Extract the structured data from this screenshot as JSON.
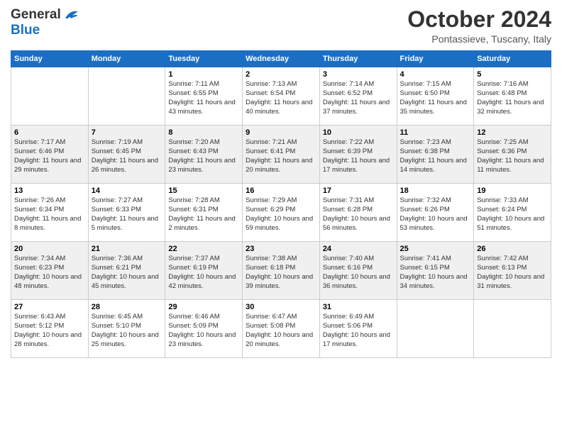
{
  "logo": {
    "general": "General",
    "blue": "Blue"
  },
  "title": "October 2024",
  "location": "Pontassieve, Tuscany, Italy",
  "days_of_week": [
    "Sunday",
    "Monday",
    "Tuesday",
    "Wednesday",
    "Thursday",
    "Friday",
    "Saturday"
  ],
  "weeks": [
    [
      {
        "day": "",
        "info": ""
      },
      {
        "day": "",
        "info": ""
      },
      {
        "day": "1",
        "info": "Sunrise: 7:11 AM\nSunset: 6:55 PM\nDaylight: 11 hours and 43 minutes."
      },
      {
        "day": "2",
        "info": "Sunrise: 7:13 AM\nSunset: 6:54 PM\nDaylight: 11 hours and 40 minutes."
      },
      {
        "day": "3",
        "info": "Sunrise: 7:14 AM\nSunset: 6:52 PM\nDaylight: 11 hours and 37 minutes."
      },
      {
        "day": "4",
        "info": "Sunrise: 7:15 AM\nSunset: 6:50 PM\nDaylight: 11 hours and 35 minutes."
      },
      {
        "day": "5",
        "info": "Sunrise: 7:16 AM\nSunset: 6:48 PM\nDaylight: 11 hours and 32 minutes."
      }
    ],
    [
      {
        "day": "6",
        "info": "Sunrise: 7:17 AM\nSunset: 6:46 PM\nDaylight: 11 hours and 29 minutes."
      },
      {
        "day": "7",
        "info": "Sunrise: 7:19 AM\nSunset: 6:45 PM\nDaylight: 11 hours and 26 minutes."
      },
      {
        "day": "8",
        "info": "Sunrise: 7:20 AM\nSunset: 6:43 PM\nDaylight: 11 hours and 23 minutes."
      },
      {
        "day": "9",
        "info": "Sunrise: 7:21 AM\nSunset: 6:41 PM\nDaylight: 11 hours and 20 minutes."
      },
      {
        "day": "10",
        "info": "Sunrise: 7:22 AM\nSunset: 6:39 PM\nDaylight: 11 hours and 17 minutes."
      },
      {
        "day": "11",
        "info": "Sunrise: 7:23 AM\nSunset: 6:38 PM\nDaylight: 11 hours and 14 minutes."
      },
      {
        "day": "12",
        "info": "Sunrise: 7:25 AM\nSunset: 6:36 PM\nDaylight: 11 hours and 11 minutes."
      }
    ],
    [
      {
        "day": "13",
        "info": "Sunrise: 7:26 AM\nSunset: 6:34 PM\nDaylight: 11 hours and 8 minutes."
      },
      {
        "day": "14",
        "info": "Sunrise: 7:27 AM\nSunset: 6:33 PM\nDaylight: 11 hours and 5 minutes."
      },
      {
        "day": "15",
        "info": "Sunrise: 7:28 AM\nSunset: 6:31 PM\nDaylight: 11 hours and 2 minutes."
      },
      {
        "day": "16",
        "info": "Sunrise: 7:29 AM\nSunset: 6:29 PM\nDaylight: 10 hours and 59 minutes."
      },
      {
        "day": "17",
        "info": "Sunrise: 7:31 AM\nSunset: 6:28 PM\nDaylight: 10 hours and 56 minutes."
      },
      {
        "day": "18",
        "info": "Sunrise: 7:32 AM\nSunset: 6:26 PM\nDaylight: 10 hours and 53 minutes."
      },
      {
        "day": "19",
        "info": "Sunrise: 7:33 AM\nSunset: 6:24 PM\nDaylight: 10 hours and 51 minutes."
      }
    ],
    [
      {
        "day": "20",
        "info": "Sunrise: 7:34 AM\nSunset: 6:23 PM\nDaylight: 10 hours and 48 minutes."
      },
      {
        "day": "21",
        "info": "Sunrise: 7:36 AM\nSunset: 6:21 PM\nDaylight: 10 hours and 45 minutes."
      },
      {
        "day": "22",
        "info": "Sunrise: 7:37 AM\nSunset: 6:19 PM\nDaylight: 10 hours and 42 minutes."
      },
      {
        "day": "23",
        "info": "Sunrise: 7:38 AM\nSunset: 6:18 PM\nDaylight: 10 hours and 39 minutes."
      },
      {
        "day": "24",
        "info": "Sunrise: 7:40 AM\nSunset: 6:16 PM\nDaylight: 10 hours and 36 minutes."
      },
      {
        "day": "25",
        "info": "Sunrise: 7:41 AM\nSunset: 6:15 PM\nDaylight: 10 hours and 34 minutes."
      },
      {
        "day": "26",
        "info": "Sunrise: 7:42 AM\nSunset: 6:13 PM\nDaylight: 10 hours and 31 minutes."
      }
    ],
    [
      {
        "day": "27",
        "info": "Sunrise: 6:43 AM\nSunset: 5:12 PM\nDaylight: 10 hours and 28 minutes."
      },
      {
        "day": "28",
        "info": "Sunrise: 6:45 AM\nSunset: 5:10 PM\nDaylight: 10 hours and 25 minutes."
      },
      {
        "day": "29",
        "info": "Sunrise: 6:46 AM\nSunset: 5:09 PM\nDaylight: 10 hours and 23 minutes."
      },
      {
        "day": "30",
        "info": "Sunrise: 6:47 AM\nSunset: 5:08 PM\nDaylight: 10 hours and 20 minutes."
      },
      {
        "day": "31",
        "info": "Sunrise: 6:49 AM\nSunset: 5:06 PM\nDaylight: 10 hours and 17 minutes."
      },
      {
        "day": "",
        "info": ""
      },
      {
        "day": "",
        "info": ""
      }
    ]
  ]
}
